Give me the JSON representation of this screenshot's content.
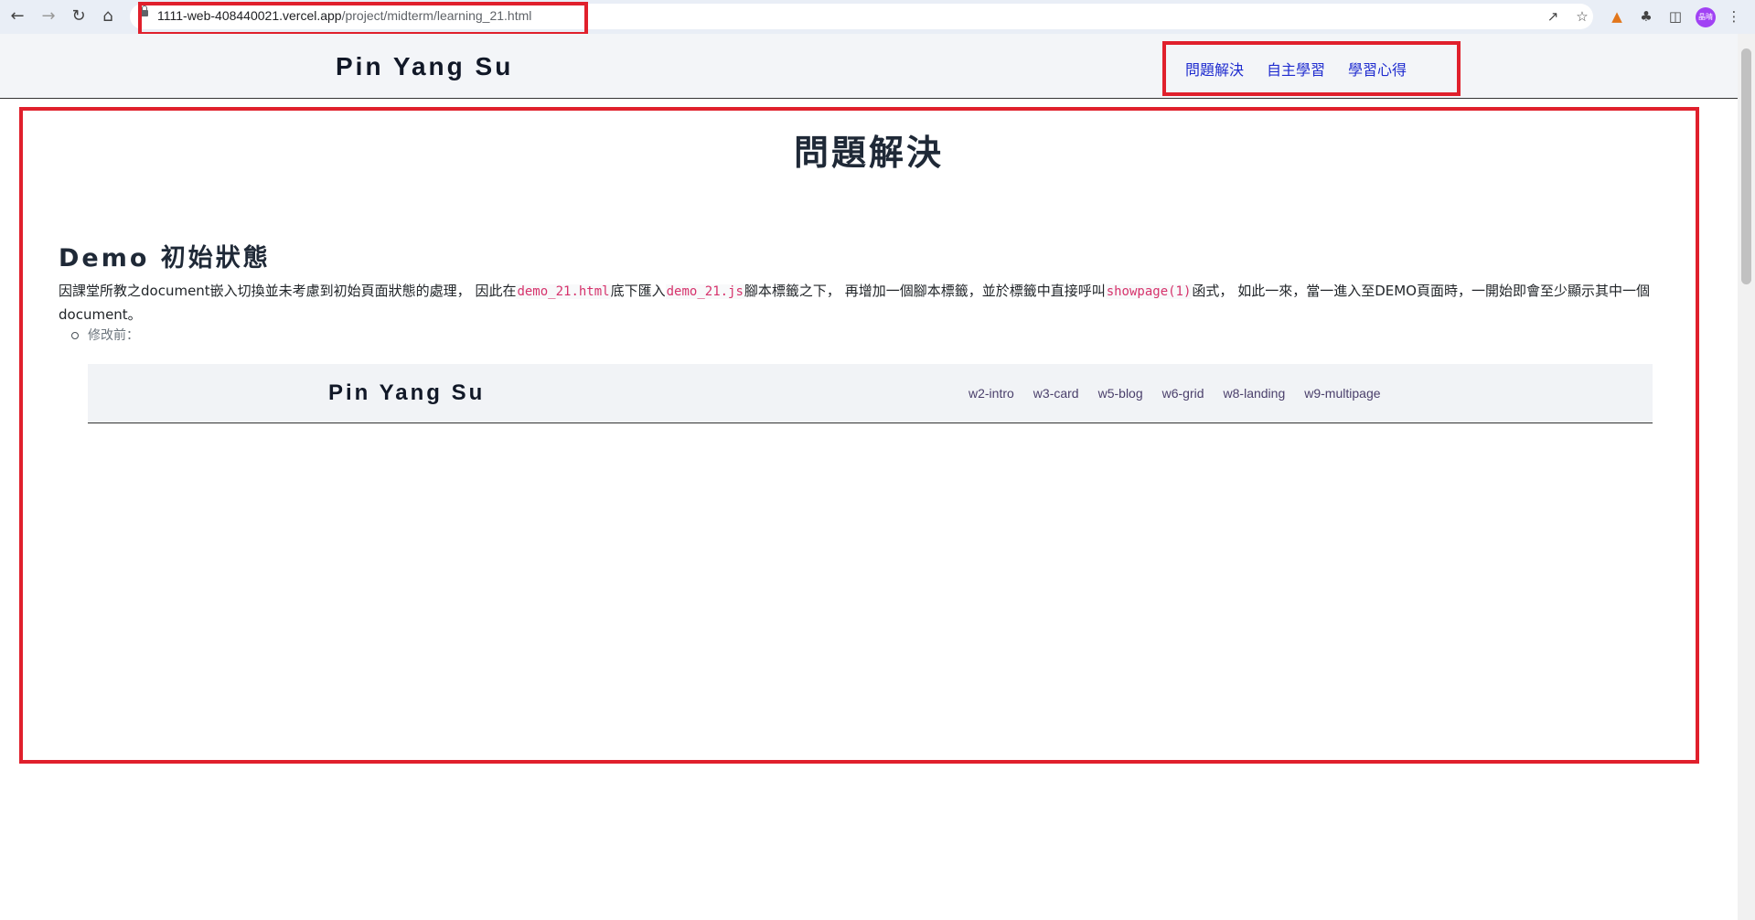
{
  "browser": {
    "url_host": "1111-web-408440021.vercel.app",
    "url_path": "/project/midterm/learning_21.html",
    "avatar_text": "晶晴",
    "icons": [
      "back-icon",
      "forward-icon",
      "reload-icon",
      "home-icon",
      "share-icon",
      "star-icon",
      "fox-extension-icon",
      "puzzle-icon",
      "sidepanel-icon",
      "more-icon"
    ]
  },
  "site": {
    "brand": "Pin Yang Su",
    "nav": [
      "問題解決",
      "自主學習",
      "學習心得"
    ]
  },
  "main": {
    "page_title": "問題解決",
    "section_title": "Demo 初始狀態",
    "para": {
      "t1": "因課堂所教之document嵌入切換並未考慮到初始頁面狀態的處理， 因此在",
      "c1": "demo_21.html",
      "t2": "底下匯入",
      "c2": "demo_21.js",
      "t3": "腳本標籤之下， 再增加一個腳本標籤，並於標籤中直接呼叫",
      "c3": "showpage(1)",
      "t4": "函式， 如此一來，當一進入至DEMO頁面時，一開始即會至少顯示其中一個document。"
    },
    "bullet": "修改前："
  },
  "preview": {
    "brand": "Pin Yang Su",
    "nav": [
      "w2-intro",
      "w3-card",
      "w5-blog",
      "w6-grid",
      "w8-landing",
      "w9-multipage"
    ]
  },
  "colors": {
    "highlight_box": "#e0202c",
    "nav_link": "#1f2ccf",
    "code": "#d6336c"
  }
}
